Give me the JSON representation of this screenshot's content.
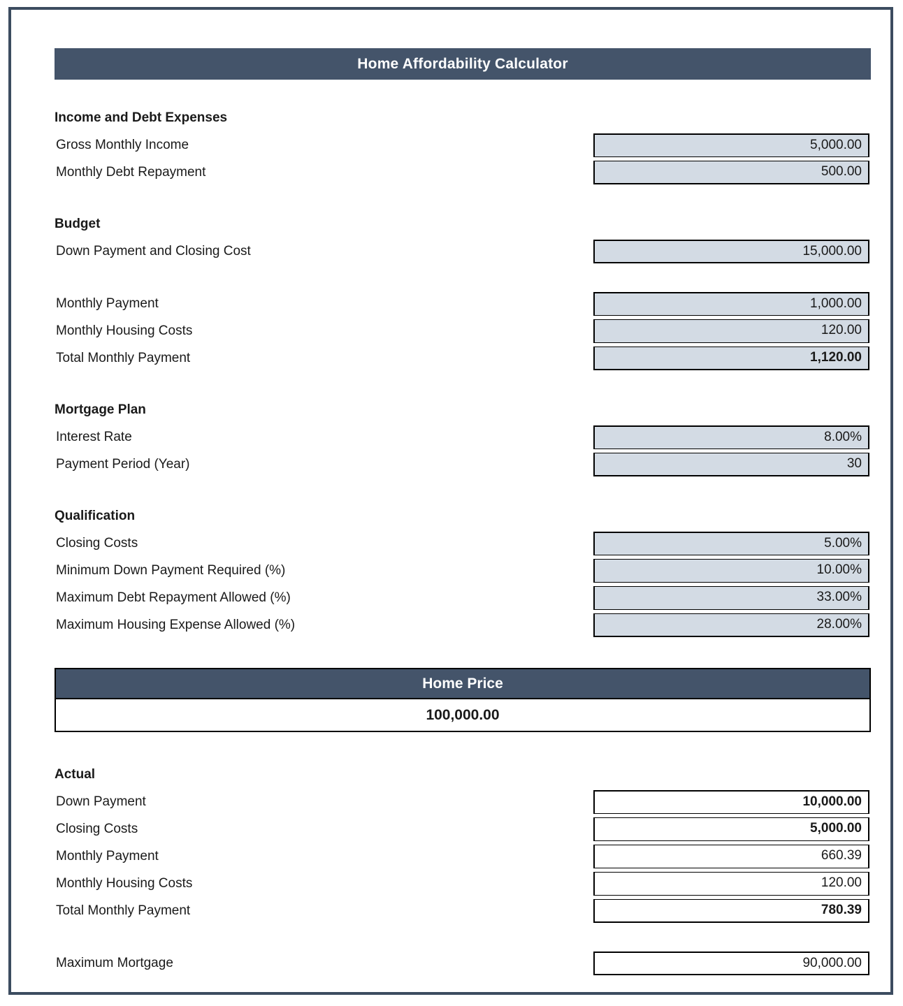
{
  "document": {
    "title": "Home Affordability Calculator",
    "accent_color": "#44546a",
    "input_fill_color": "#d3dbe4",
    "border_color": "#000000",
    "frame_color": "#3c4c60"
  },
  "sections": {
    "income_and_debt": {
      "heading": "Income and Debt Expenses",
      "rows": [
        {
          "label": "Gross Monthly Income",
          "value": "5,000.00"
        },
        {
          "label": "Monthly Debt Repayment",
          "value": "500.00"
        }
      ]
    },
    "budget": {
      "heading": "Budget",
      "down_payment_row": {
        "label": "Down Payment and Closing Cost",
        "value": "15,000.00"
      },
      "payment_rows": [
        {
          "label": "Monthly Payment",
          "value": "1,000.00"
        },
        {
          "label": "Monthly Housing Costs",
          "value": "120.00"
        },
        {
          "label": "Total Monthly Payment",
          "value": "1,120.00"
        }
      ]
    },
    "mortgage_plan": {
      "heading": "Mortgage Plan",
      "rows": [
        {
          "label": "Interest Rate",
          "value": "8.00%"
        },
        {
          "label": "Payment Period (Year)",
          "value": "30"
        }
      ]
    },
    "qualification": {
      "heading": "Qualification",
      "rows": [
        {
          "label": "Closing Costs",
          "value": "5.00%"
        },
        {
          "label": "Minimum Down Payment Required (%)",
          "value": "10.00%"
        },
        {
          "label": "Maximum Debt Repayment Allowed (%)",
          "value": "33.00%"
        },
        {
          "label": "Maximum Housing Expense Allowed (%)",
          "value": "28.00%"
        }
      ]
    },
    "home_price": {
      "heading": "Home Price",
      "value": "100,000.00"
    },
    "actual": {
      "heading": "Actual",
      "rows": [
        {
          "label": "Down Payment",
          "value": "10,000.00"
        },
        {
          "label": "Closing Costs",
          "value": "5,000.00"
        },
        {
          "label": "Monthly Payment",
          "value": "660.39"
        },
        {
          "label": "Monthly Housing Costs",
          "value": "120.00"
        },
        {
          "label": "Total Monthly Payment",
          "value": "780.39"
        }
      ],
      "maximum_mortgage": {
        "label": "Maximum Mortgage",
        "value": "90,000.00"
      }
    }
  }
}
